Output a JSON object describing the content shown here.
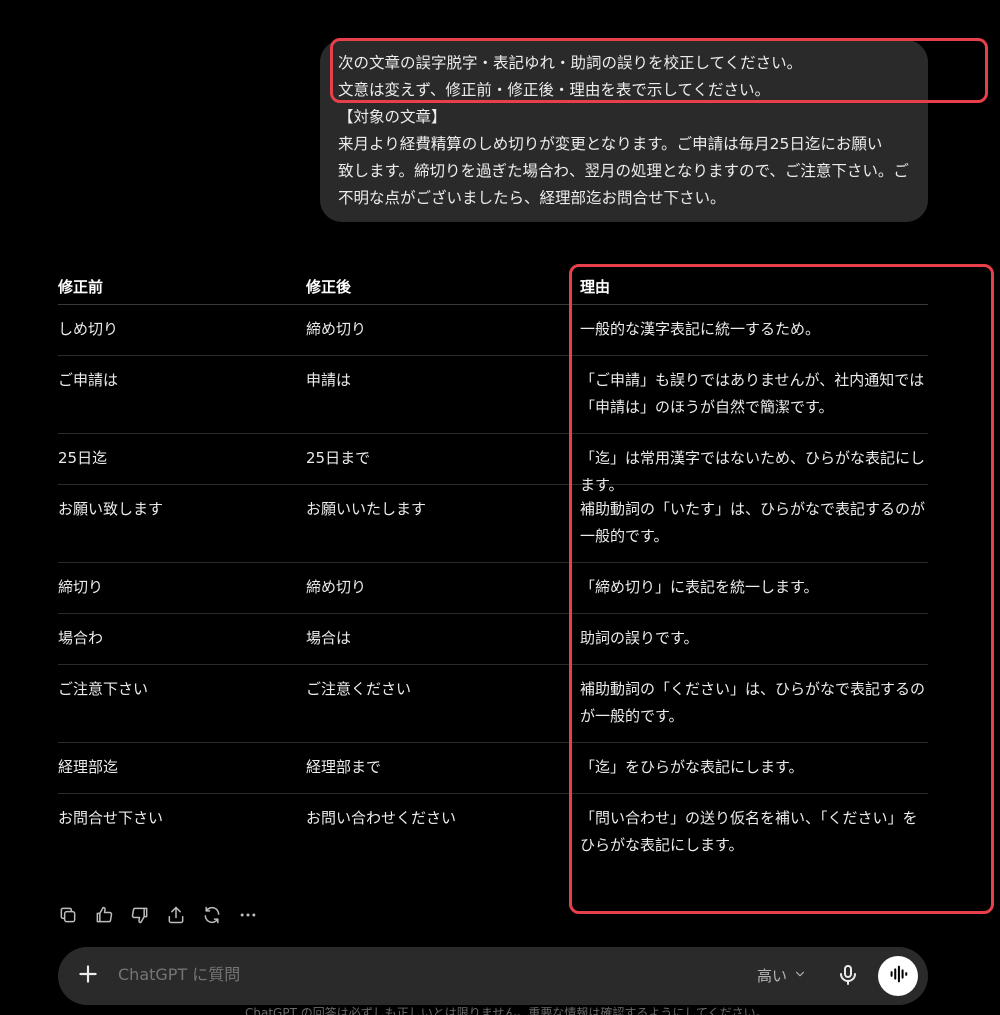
{
  "user_message": {
    "lines": [
      "次の文章の誤字脱字・表記ゆれ・助詞の誤りを校正してください。",
      "文意は変えず、修正前・修正後・理由を表で示してください。",
      "【対象の文章】",
      "来月より経費精算のしめ切りが変更となります。ご申請は毎月25日迄にお願い",
      "致します。締切りを過ぎた場合わ、翌月の処理となりますので、ご注意下さい。ご",
      "不明な点がございましたら、経理部迄お問合せ下さい。"
    ]
  },
  "table": {
    "headers": [
      "修正前",
      "修正後",
      "理由"
    ],
    "rows": [
      {
        "before": "しめ切り",
        "after": "締め切り",
        "reason": "一般的な漢字表記に統一するため。"
      },
      {
        "before": "ご申請は",
        "after": "申請は",
        "reason": "「ご申請」も誤りではありませんが、社内通知では「申請は」のほうが自然で簡潔です。"
      },
      {
        "before": "25日迄",
        "after": "25日まで",
        "reason": "「迄」は常用漢字ではないため、ひらがな表記にします。"
      },
      {
        "before": "お願い致します",
        "after": "お願いいたします",
        "reason": "補助動詞の「いたす」は、ひらがなで表記するのが一般的です。"
      },
      {
        "before": "締切り",
        "after": "締め切り",
        "reason": "「締め切り」に表記を統一します。"
      },
      {
        "before": "場合わ",
        "after": "場合は",
        "reason": "助詞の誤りです。"
      },
      {
        "before": "ご注意下さい",
        "after": "ご注意ください",
        "reason": "補助動詞の「ください」は、ひらがなで表記するのが一般的です。"
      },
      {
        "before": "経理部迄",
        "after": "経理部まで",
        "reason": "「迄」をひらがな表記にします。"
      },
      {
        "before": "お問合せ下さい",
        "after": "お問い合わせください",
        "reason": "「問い合わせ」の送り仮名を補い、「ください」をひらがな表記にします。"
      }
    ]
  },
  "actions": [
    "copy-icon",
    "thumbs-up-icon",
    "thumbs-down-icon",
    "share-icon",
    "regenerate-icon",
    "more-icon"
  ],
  "composer": {
    "placeholder": "ChatGPT に質問",
    "model_label": "高い"
  },
  "footer": {
    "note": "ChatGPT の回答は必ずしも正しいとは限りません。重要な情報は確認するようにしてください。"
  },
  "colors": {
    "background": "#000000",
    "bubble": "#2a2a2a",
    "highlight": "#e8404a"
  }
}
